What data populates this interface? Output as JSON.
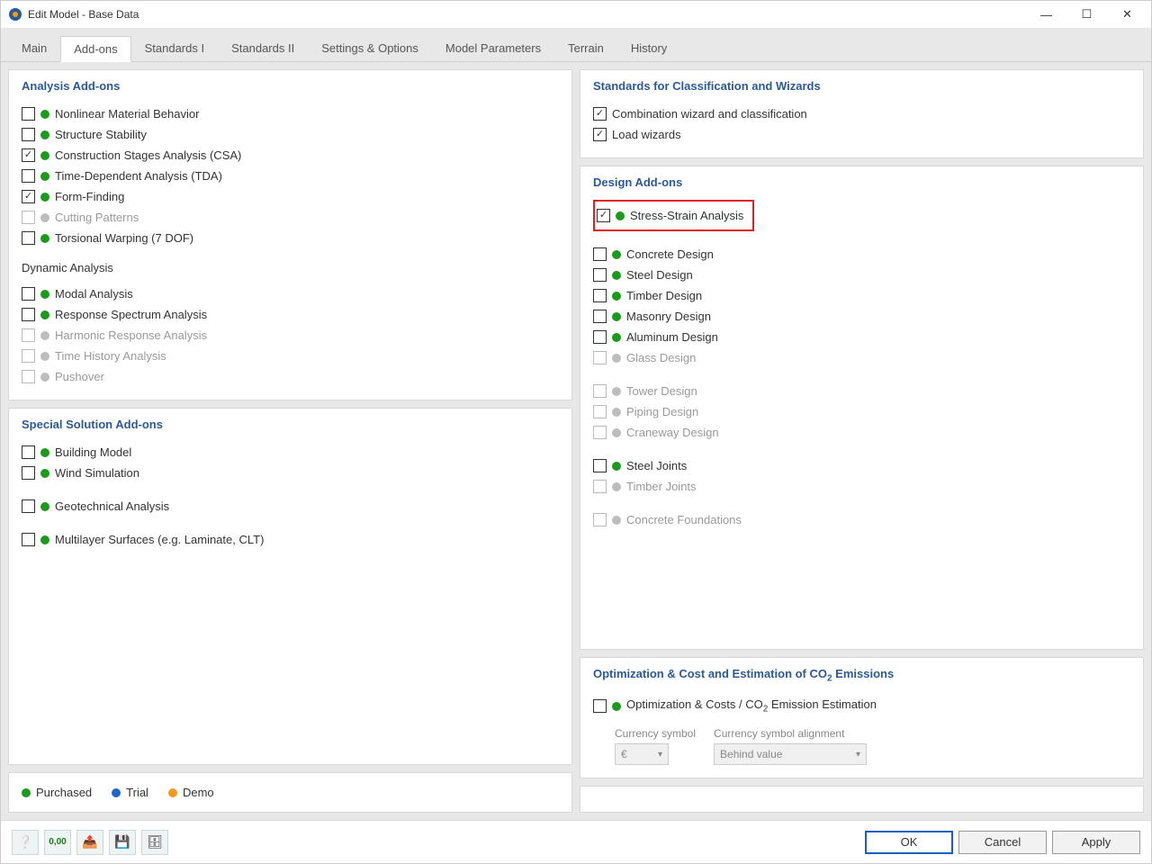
{
  "window": {
    "title": "Edit Model - Base Data"
  },
  "tabs": [
    "Main",
    "Add-ons",
    "Standards I",
    "Standards II",
    "Settings & Options",
    "Model Parameters",
    "Terrain",
    "History"
  ],
  "active_tab": 1,
  "analysis": {
    "title": "Analysis Add-ons",
    "items": [
      {
        "label": "Nonlinear Material Behavior",
        "checked": false,
        "status": "green"
      },
      {
        "label": "Structure Stability",
        "checked": false,
        "status": "green"
      },
      {
        "label": "Construction Stages Analysis (CSA)",
        "checked": true,
        "status": "green"
      },
      {
        "label": "Time-Dependent Analysis (TDA)",
        "checked": false,
        "status": "green"
      },
      {
        "label": "Form-Finding",
        "checked": true,
        "status": "green"
      },
      {
        "label": "Cutting Patterns",
        "checked": false,
        "status": "gray",
        "disabled": true
      },
      {
        "label": "Torsional Warping (7 DOF)",
        "checked": false,
        "status": "green"
      }
    ],
    "dynamic_heading": "Dynamic Analysis",
    "dynamic_items": [
      {
        "label": "Modal Analysis",
        "checked": false,
        "status": "green"
      },
      {
        "label": "Response Spectrum Analysis",
        "checked": false,
        "status": "green"
      },
      {
        "label": "Harmonic Response Analysis",
        "checked": false,
        "status": "gray",
        "disabled": true
      },
      {
        "label": "Time History Analysis",
        "checked": false,
        "status": "gray",
        "disabled": true
      },
      {
        "label": "Pushover",
        "checked": false,
        "status": "gray",
        "disabled": true
      }
    ]
  },
  "special": {
    "title": "Special Solution Add-ons",
    "items": [
      {
        "label": "Building Model",
        "checked": false,
        "status": "green"
      },
      {
        "label": "Wind Simulation",
        "checked": false,
        "status": "green",
        "gap_after": true
      },
      {
        "label": "Geotechnical Analysis",
        "checked": false,
        "status": "green",
        "gap_after": true
      },
      {
        "label": "Multilayer Surfaces (e.g. Laminate, CLT)",
        "checked": false,
        "status": "green"
      }
    ]
  },
  "standards_wiz": {
    "title": "Standards for Classification and Wizards",
    "items": [
      {
        "label": "Combination wizard and classification",
        "checked": true
      },
      {
        "label": "Load wizards",
        "checked": true
      }
    ]
  },
  "design": {
    "title": "Design Add-ons",
    "highlight": {
      "label": "Stress-Strain Analysis",
      "checked": true,
      "status": "green"
    },
    "group1": [
      {
        "label": "Concrete Design",
        "checked": false,
        "status": "green"
      },
      {
        "label": "Steel Design",
        "checked": false,
        "status": "green"
      },
      {
        "label": "Timber Design",
        "checked": false,
        "status": "green"
      },
      {
        "label": "Masonry Design",
        "checked": false,
        "status": "green"
      },
      {
        "label": "Aluminum Design",
        "checked": false,
        "status": "green"
      },
      {
        "label": "Glass Design",
        "checked": false,
        "status": "gray",
        "disabled": true
      }
    ],
    "group2": [
      {
        "label": "Tower Design",
        "checked": false,
        "status": "gray",
        "disabled": true
      },
      {
        "label": "Piping Design",
        "checked": false,
        "status": "gray",
        "disabled": true
      },
      {
        "label": "Craneway Design",
        "checked": false,
        "status": "gray",
        "disabled": true
      }
    ],
    "group3": [
      {
        "label": "Steel Joints",
        "checked": false,
        "status": "green"
      },
      {
        "label": "Timber Joints",
        "checked": false,
        "status": "gray",
        "disabled": true
      }
    ],
    "group4": [
      {
        "label": "Concrete Foundations",
        "checked": false,
        "status": "gray",
        "disabled": true
      }
    ]
  },
  "optimization": {
    "title_pre": "Optimization & Cost and Estimation of CO",
    "title_sub": "2",
    "title_post": " Emissions",
    "item_pre": "Optimization & Costs / CO",
    "item_sub": "2",
    "item_post": " Emission Estimation",
    "currency_label": "Currency symbol",
    "currency_value": "€",
    "align_label": "Currency symbol alignment",
    "align_value": "Behind value"
  },
  "legend": {
    "purchased": "Purchased",
    "trial": "Trial",
    "demo": "Demo"
  },
  "footer": {
    "ok": "OK",
    "cancel": "Cancel",
    "apply": "Apply"
  }
}
